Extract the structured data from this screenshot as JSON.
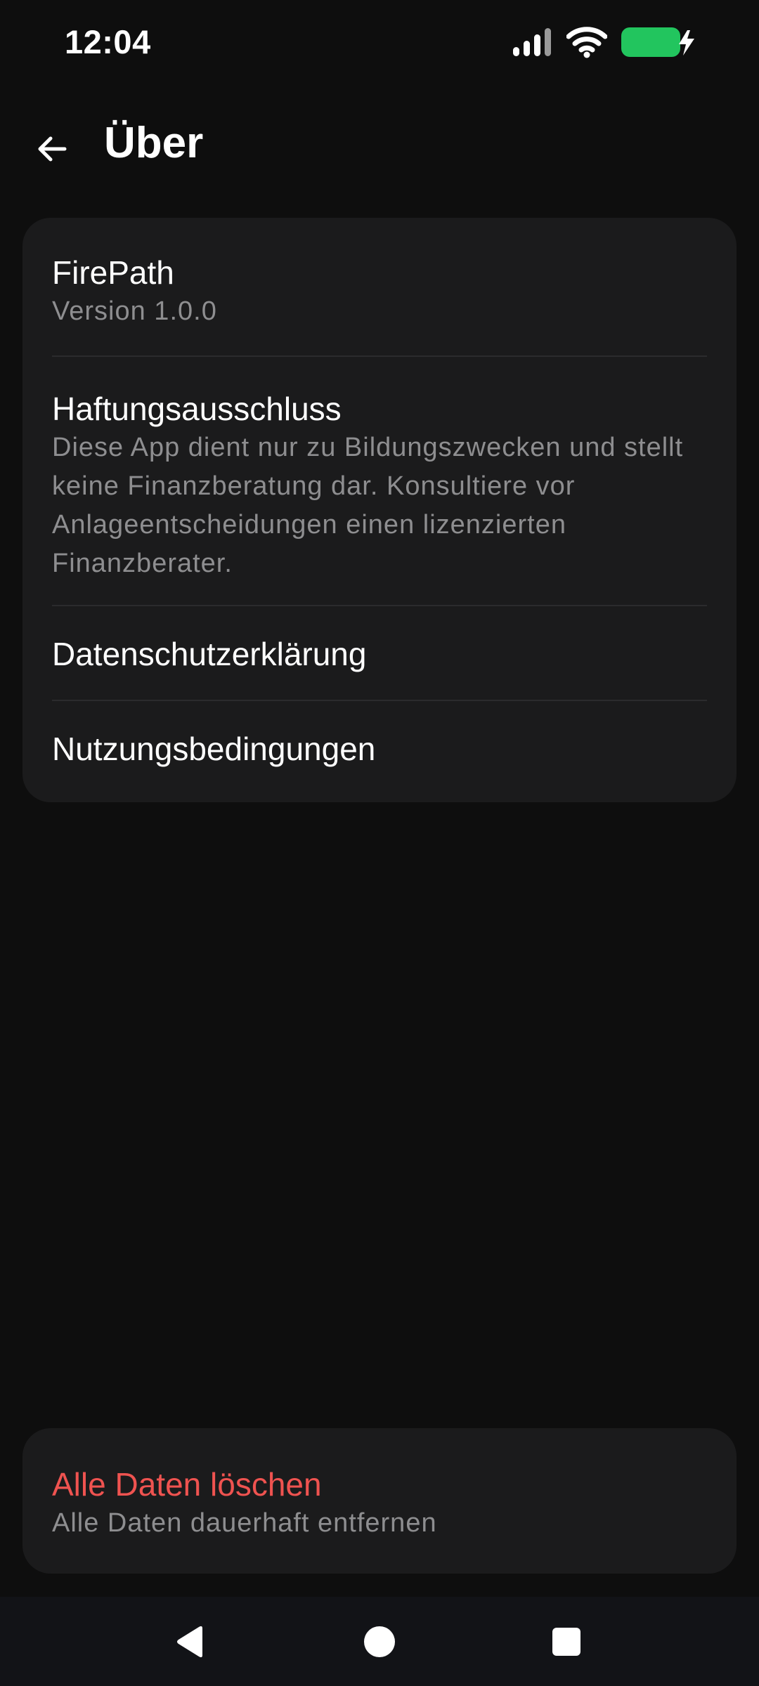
{
  "status_bar": {
    "time": "12:04",
    "icons": [
      "signal-icon",
      "wifi-icon",
      "battery-charging-icon"
    ],
    "battery_color": "#22c55e"
  },
  "app_bar": {
    "back_icon": "arrow-left-icon",
    "title": "Über"
  },
  "about_card": {
    "app_name": "FirePath",
    "version": "Version 1.0.0",
    "disclaimer_title": "Haftungsausschluss",
    "disclaimer_text": "Diese App dient nur zu Bildungszwecken und stellt keine Finanzberatung dar. Konsultiere vor Anlageentscheidungen einen lizenzierten Finanzberater.",
    "privacy_label": "Datenschutzerklärung",
    "terms_label": "Nutzungsbedingungen"
  },
  "danger_card": {
    "title": "Alle Daten löschen",
    "subtitle": "Alle Daten dauerhaft entfernen",
    "accent_color": "#ef5350"
  },
  "nav_bar": {
    "icons": [
      "nav-back-icon",
      "nav-home-icon",
      "nav-recents-icon"
    ]
  }
}
